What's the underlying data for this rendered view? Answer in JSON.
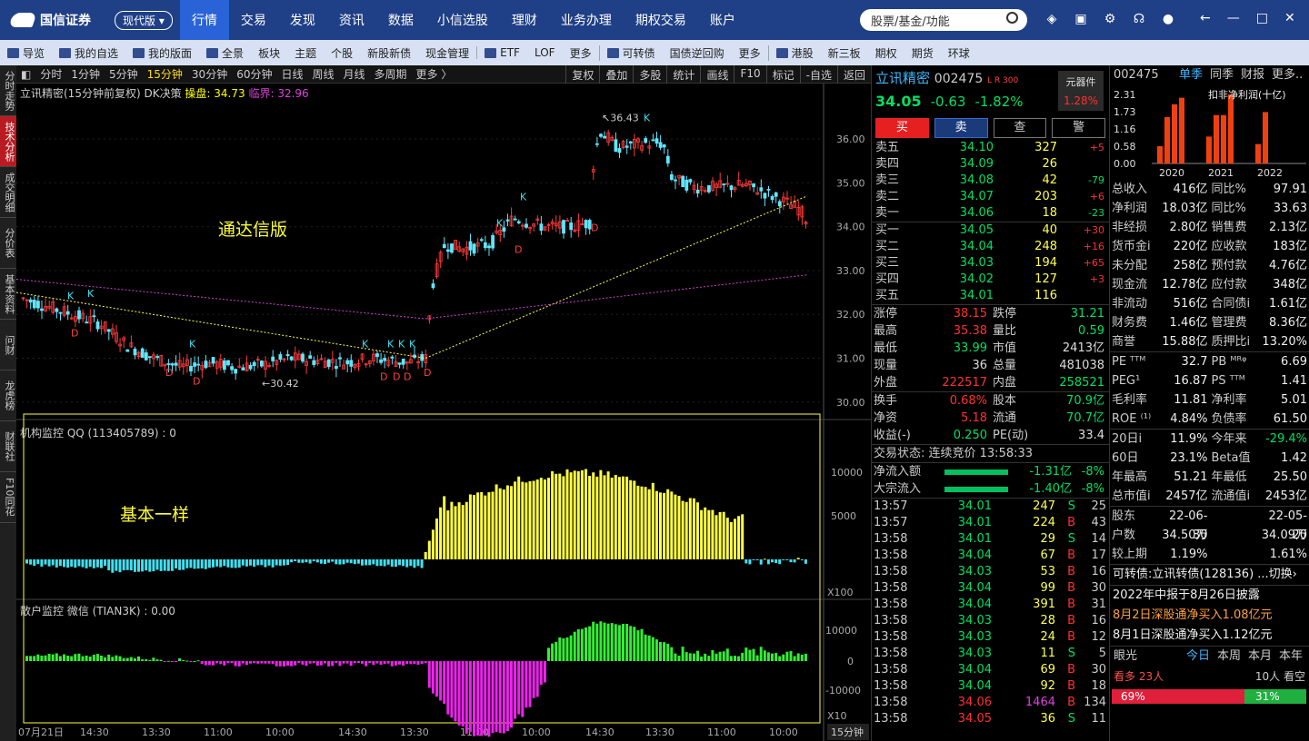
{
  "app": {
    "logo_text": "国信证券",
    "logo_sub": "GUOSEN SECURITIES",
    "mode": "现代版 ▾"
  },
  "main_nav": [
    "行情",
    "交易",
    "发现",
    "资讯",
    "数据",
    "小信选股",
    "理财",
    "业务办理",
    "期权交易",
    "账户"
  ],
  "search": {
    "placeholder": "股票/基金/功能"
  },
  "toolbar": [
    "导览",
    "我的自选",
    "我的版面",
    "全景",
    "板块",
    "主题",
    "个股",
    "新股新债",
    "现金管理",
    "ETF",
    "LOF",
    "更多",
    "可转债",
    "国债逆回购",
    "更多",
    "港股",
    "新三板",
    "期权",
    "期货",
    "环球"
  ],
  "left_tabs": [
    "分时走势",
    "技术分析",
    "成交明细",
    "分价表",
    "基本资料",
    "问财",
    "龙虎榜",
    "财联社",
    "F10同花"
  ],
  "periods": [
    "分时",
    "1分钟",
    "5分钟",
    "15分钟",
    "30分钟",
    "60分钟",
    "日线",
    "周线",
    "月线",
    "多周期",
    "更多 〉"
  ],
  "period_right": [
    "复权",
    "叠加",
    "多股",
    "统计",
    "画线",
    "F10",
    "标记",
    "-自选",
    "返回"
  ],
  "chart": {
    "title_prefix": "立讯精密(15分钟前复权)",
    "indicator": "DK决策",
    "pan_label": "操盘: 34.73",
    "lin_label": "临界: 32.96",
    "price_ticks": [
      "36.00",
      "35.00",
      "34.00",
      "33.00",
      "32.00",
      "31.00",
      "30.00"
    ],
    "high_label": "36.43",
    "low_label": "30.42",
    "sub1_title": "机构监控 QQ (113405789) : 0",
    "sub1_ticks": [
      "10000",
      "5000",
      "X100"
    ],
    "sub2_title": "散户监控 微信 (TIAN3K) : 0.00",
    "sub2_ticks": [
      "10000",
      "0",
      "-10000",
      "X10"
    ],
    "time_labels": [
      "07月21日",
      "14:30",
      "13:30",
      "11:00",
      "10:00",
      "14:30",
      "13:30",
      "11:00",
      "10:00",
      "14:30",
      "13:30",
      "11:00",
      "10:00"
    ],
    "period_tag": "15分钟",
    "annot1": "通达信版",
    "annot2": "基本一样",
    "colors": {
      "up": "#ff3b3b",
      "down": "#5fe6ff",
      "inst_pos": "#ffff44",
      "inst_neg": "#40e0f0",
      "retail_pos": "#33ee33",
      "retail_neg": "#ee22ee"
    }
  },
  "quote": {
    "name": "立讯精密",
    "code": "002475",
    "tags": "L R 300",
    "price": "34.05",
    "change": "-0.63",
    "pct": "-1.82%",
    "sector": "元器件",
    "sector_pct": "1.28%",
    "trade_buttons": [
      "买",
      "卖",
      "查",
      "警"
    ],
    "asks": [
      {
        "label": "卖五",
        "price": "34.10",
        "vol": "327",
        "chg": "+5"
      },
      {
        "label": "卖四",
        "price": "34.09",
        "vol": "26",
        "chg": ""
      },
      {
        "label": "卖三",
        "price": "34.08",
        "vol": "42",
        "chg": "-79"
      },
      {
        "label": "卖二",
        "price": "34.07",
        "vol": "203",
        "chg": "+6"
      },
      {
        "label": "卖一",
        "price": "34.06",
        "vol": "18",
        "chg": "-23"
      }
    ],
    "bids": [
      {
        "label": "买一",
        "price": "34.05",
        "vol": "40",
        "chg": "+30"
      },
      {
        "label": "买二",
        "price": "34.04",
        "vol": "248",
        "chg": "+16"
      },
      {
        "label": "买三",
        "price": "34.03",
        "vol": "194",
        "chg": "+65"
      },
      {
        "label": "买四",
        "price": "34.02",
        "vol": "127",
        "chg": "+3"
      },
      {
        "label": "买五",
        "price": "34.01",
        "vol": "116",
        "chg": ""
      }
    ],
    "stats": [
      [
        "涨停",
        "38.15",
        "跌停",
        "31.21"
      ],
      [
        "最高",
        "35.38",
        "量比",
        "0.59"
      ],
      [
        "最低",
        "33.99",
        "市值",
        "2413亿"
      ],
      [
        "现量",
        "36",
        "总量",
        "481038"
      ],
      [
        "外盘",
        "222517",
        "内盘",
        "258521"
      ]
    ],
    "stats2": [
      [
        "换手",
        "0.68%",
        "股本",
        "70.9亿"
      ],
      [
        "净资",
        "5.18",
        "流通",
        "70.7亿"
      ],
      [
        "收益(-)",
        "0.250",
        "PE(动)",
        "33.4"
      ]
    ],
    "trade_status": "交易状态: 连续竞价 13:58:33",
    "flows": [
      {
        "label": "净流入额",
        "value": "-1.31亿",
        "pct": "-8%"
      },
      {
        "label": "大宗流入",
        "value": "-1.40亿",
        "pct": "-8%"
      }
    ],
    "ticks": [
      [
        "13:57",
        "34.01",
        "247",
        "S",
        "25"
      ],
      [
        "13:57",
        "34.01",
        "224",
        "B",
        "43"
      ],
      [
        "13:58",
        "34.01",
        "29",
        "S",
        "14"
      ],
      [
        "13:58",
        "34.04",
        "67",
        "B",
        "17"
      ],
      [
        "13:58",
        "34.03",
        "53",
        "B",
        "16"
      ],
      [
        "13:58",
        "34.04",
        "99",
        "B",
        "30"
      ],
      [
        "13:58",
        "34.04",
        "391",
        "B",
        "31"
      ],
      [
        "13:58",
        "34.03",
        "28",
        "B",
        "16"
      ],
      [
        "13:58",
        "34.03",
        "24",
        "B",
        "12"
      ],
      [
        "13:58",
        "34.03",
        "11",
        "S",
        "5"
      ],
      [
        "13:58",
        "34.04",
        "69",
        "B",
        "30"
      ],
      [
        "13:58",
        "34.04",
        "92",
        "B",
        "18"
      ],
      [
        "13:58",
        "34.06",
        "1464",
        "B",
        "134"
      ],
      [
        "13:58",
        "34.05",
        "36",
        "S",
        "11"
      ]
    ]
  },
  "fin": {
    "code": "002475",
    "tabs": [
      "单季",
      "同季",
      "财报",
      "更多.."
    ],
    "bar_title": "扣非净利润(十亿)",
    "bar_yticks": [
      "2.31",
      "1.73",
      "1.16",
      "0.58",
      "0.00"
    ],
    "bar_years": [
      "2020",
      "2021",
      "2022"
    ],
    "bar_values": [
      0.58,
      1.55,
      1.98,
      2.2,
      0.9,
      1.62,
      1.62,
      2.31,
      0.65,
      1.72
    ],
    "rows": [
      [
        "总收入",
        "416亿",
        "同比%",
        "97.91"
      ],
      [
        "净利润",
        "18.03亿",
        "同比%",
        "33.63"
      ],
      [
        "非经损",
        "2.80亿",
        "销售费",
        "2.13亿"
      ],
      [
        "货币金i",
        "220亿",
        "应收款",
        "183亿"
      ],
      [
        "未分配",
        "258亿",
        "预付款",
        "4.76亿"
      ],
      [
        "现金流",
        "12.78亿",
        "应付款",
        "348亿"
      ],
      [
        "非流动",
        "516亿",
        "合同债i",
        "1.61亿"
      ],
      [
        "财务费",
        "1.46亿",
        "管理费",
        "8.36亿"
      ],
      [
        "商誉",
        "15.88亿",
        "质押比i",
        "13.20%"
      ],
      [
        "PE ᵀᵀᴹ",
        "32.7",
        "PB ᴹᴿᵠ",
        "6.69"
      ],
      [
        "PEG¹",
        "16.87",
        "PS ᵀᵀᴹ",
        "1.41"
      ],
      [
        "毛利率",
        "11.81",
        "净利率",
        "5.01"
      ],
      [
        "ROE ⁽¹⁾",
        "4.84%",
        "负债率",
        "61.50"
      ],
      [
        "20日i",
        "11.9%",
        "今年来",
        "-29.4%"
      ],
      [
        "60日",
        "23.1%",
        "Beta值",
        "1.42"
      ],
      [
        "年最高",
        "51.21",
        "年最低",
        "25.50"
      ],
      [
        "总市值i",
        "2457亿",
        "流通值i",
        "2453亿"
      ],
      [
        "股东",
        "22-06-30",
        "",
        "22-05-20"
      ],
      [
        "户数",
        "34.50万",
        "",
        "34.09万"
      ],
      [
        "较上期",
        "1.19%",
        "",
        "1.61%"
      ]
    ],
    "cb_line": "可转债:立讯转债(128136) ...切换›",
    "news": [
      "2022年中报于8月26日披露",
      "8月2日深股通净买入1.08亿元",
      "8月1日深股通净买入1.12亿元"
    ],
    "eye_title": "眼光",
    "eye_tabs": [
      "今日",
      "本周",
      "本月",
      "本年"
    ],
    "bull": "看多 23人",
    "bear": "10人 看空",
    "bull_pct": "69%",
    "bear_pct": "31%"
  }
}
